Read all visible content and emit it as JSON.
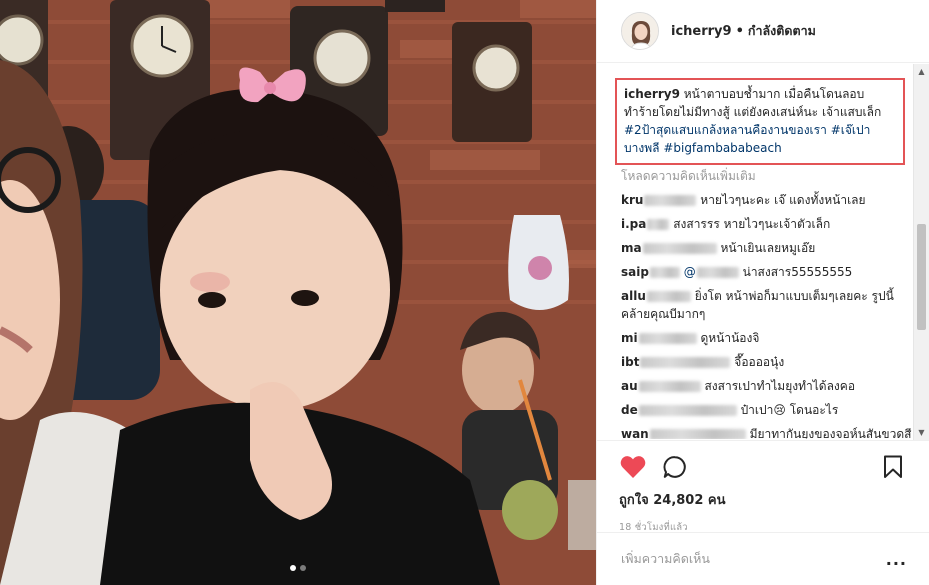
{
  "post": {
    "username": "icherry9",
    "separator": "•",
    "follow_status": "กำลังติดตาม",
    "avatar_icon": "profile-avatar",
    "photo_icon": "post-photo",
    "carousel_pages": 2,
    "carousel_active": 1
  },
  "caption": {
    "username": "icherry9",
    "text": "หน้าตาบอบช้ำมาก เมื่อคืนโดนลอบทำร้ายโดยไม่มีทางสู้ แต่ยังคงเสน่ห์นะ เจ้าแสบเล็ก",
    "tags": [
      "#2ป้าสุดแสบแกล้งหลานคืองานของเรา",
      "#เจ๊เปาบางพลี",
      "#bigfambababeach"
    ],
    "highlight_color": "#e35456"
  },
  "load_more": "โหลดความคิดเห็นเพิ่มเติม",
  "comments": [
    {
      "user": "kru",
      "text": "หายไวๆนะคะ เจ๊ แดงทั้งหน้าเลย"
    },
    {
      "user": "i.pa",
      "text": "สงสารรร หายไวๆนะเจ้าตัวเล็ก"
    },
    {
      "user": "ma",
      "text": "หน้าเยินเลยหมูเอ๊ย"
    },
    {
      "user": "saip",
      "mention": "@",
      "text": "น่าสงสาร55555555"
    },
    {
      "user": "allu",
      "text": "ยิ่งโต หน้าพ่อก็มาแบบเต็มๆเลยคะ รูปนี้คล้ายคุณบีมากๆ"
    },
    {
      "user": "mi",
      "text": "ดูหน้าน้องจิ"
    },
    {
      "user": "ibt",
      "text": "จึ๊ออออนุ๋ง"
    },
    {
      "user": "au",
      "text": "สงสารเปาทำไมยุงทำได้ลงคอ"
    },
    {
      "user": "de",
      "text": "ป๋าเปา😢 โดนอะไร"
    },
    {
      "user": "wan",
      "text": "มียาทากันยุงของจอห์นสันขวดสี"
    }
  ],
  "actions": {
    "like_icon": "heart-icon",
    "comment_icon": "comment-icon",
    "bookmark_icon": "bookmark-icon",
    "like_color": "#ed4956",
    "likes_label": "ถูกใจ 24,802 คน",
    "time_ago": "18 ชั่วโมงที่แล้ว"
  },
  "add_comment": {
    "placeholder": "เพิ่มความคิดเห็น",
    "options": "..."
  }
}
